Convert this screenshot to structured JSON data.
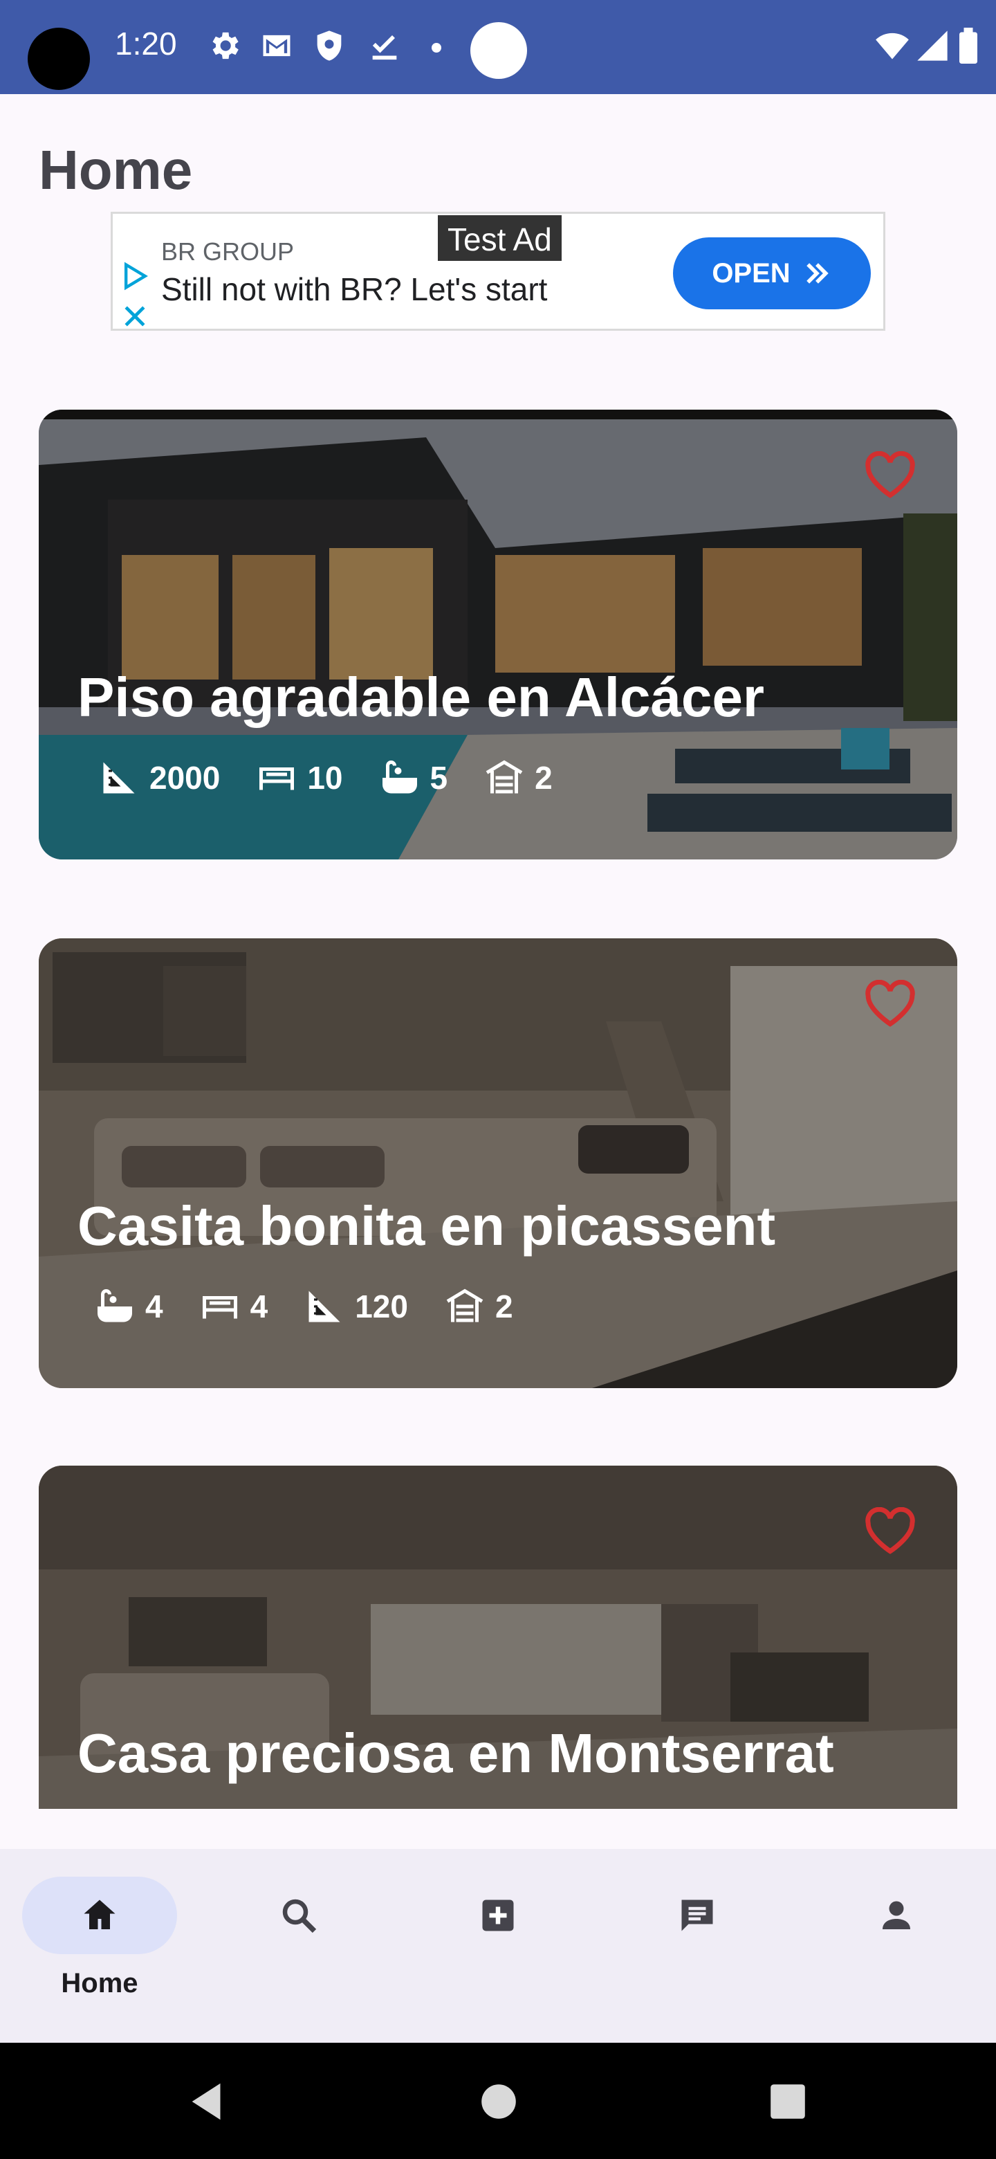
{
  "status_bar": {
    "time": "1:20",
    "icons": [
      "settings-icon",
      "gmail-icon",
      "shield-icon",
      "task-check-icon",
      "dot-icon",
      "wifi-icon",
      "signal-icon",
      "battery-icon"
    ],
    "color": "#3F5AA9"
  },
  "page": {
    "title": "Home"
  },
  "ad": {
    "brand": "BR GROUP",
    "text": "Still not with BR? Let's start",
    "label": "Test Ad",
    "cta": "OPEN",
    "cta_color": "#1A73E8"
  },
  "listings": [
    {
      "title": "Piso agradable en Alcácer",
      "specs": [
        {
          "icon": "area-icon",
          "value": "2000"
        },
        {
          "icon": "bed-icon",
          "value": "10"
        },
        {
          "icon": "bathtub-icon",
          "value": "5"
        },
        {
          "icon": "garage-icon",
          "value": "2"
        }
      ],
      "favorite": false
    },
    {
      "title": "Casita bonita en picassent",
      "specs": [
        {
          "icon": "bathtub-icon",
          "value": "4"
        },
        {
          "icon": "bed-icon",
          "value": "4"
        },
        {
          "icon": "area-icon",
          "value": "120"
        },
        {
          "icon": "garage-icon",
          "value": "2"
        }
      ],
      "favorite": false
    },
    {
      "title": "Casa preciosa en Montserrat",
      "specs": [],
      "favorite": false
    }
  ],
  "bottom_nav": {
    "items": [
      {
        "icon": "home-icon",
        "label": "Home",
        "active": true
      },
      {
        "icon": "search-icon",
        "label": "",
        "active": false
      },
      {
        "icon": "add-box-icon",
        "label": "",
        "active": false
      },
      {
        "icon": "chat-icon",
        "label": "",
        "active": false
      },
      {
        "icon": "person-icon",
        "label": "",
        "active": false
      }
    ]
  },
  "colors": {
    "favorite": "#D32F2F",
    "nav_active": "#DDE1F9"
  }
}
